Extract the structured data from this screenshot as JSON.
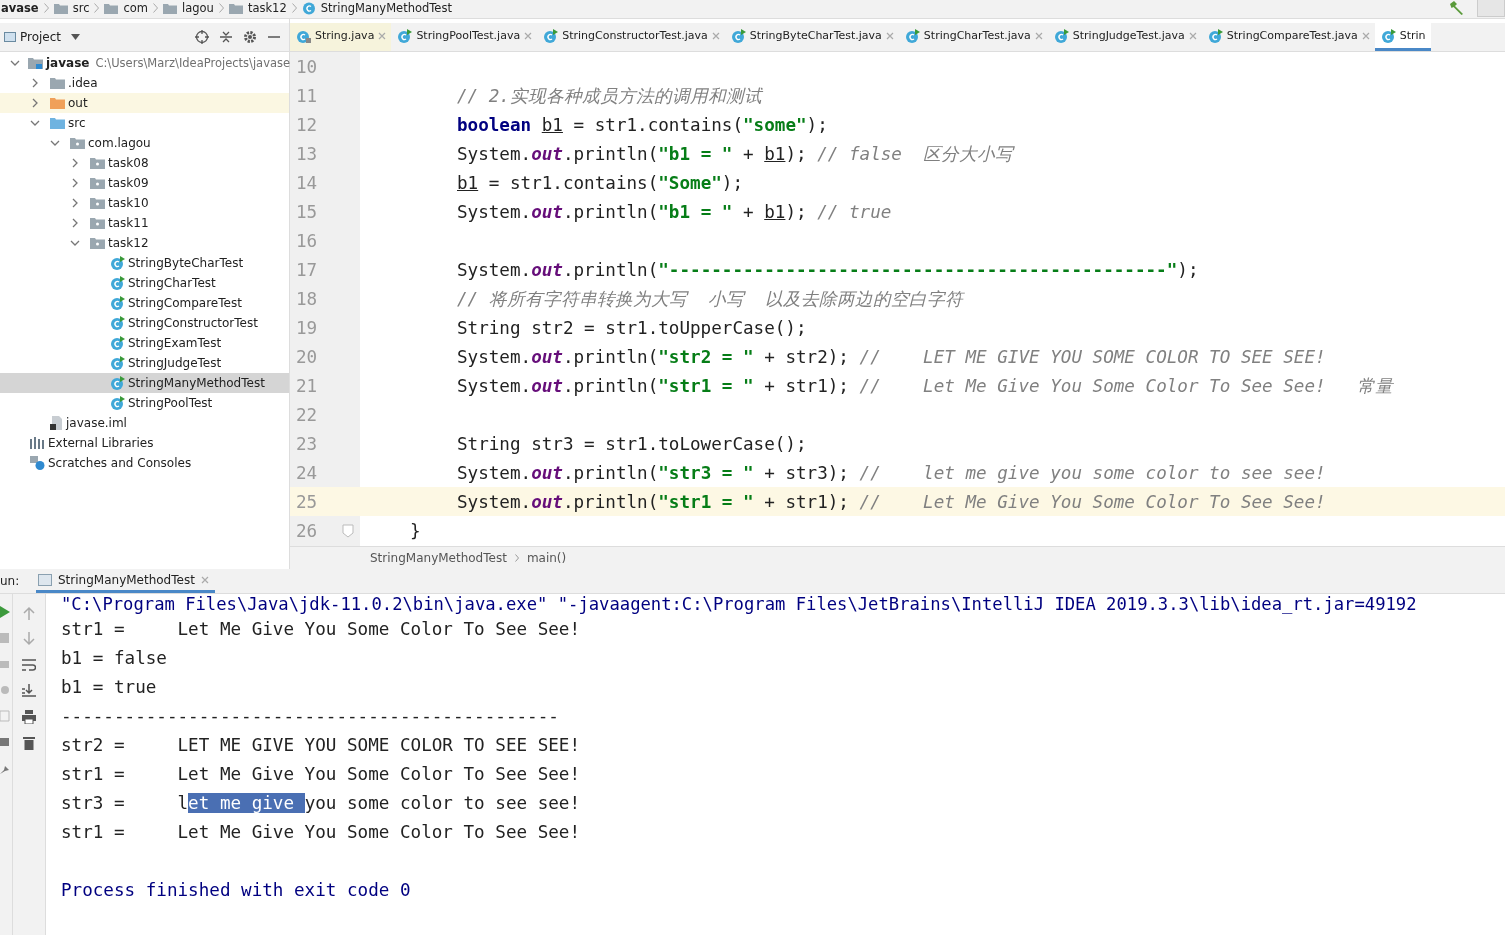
{
  "breadcrumbs": [
    "avase",
    "src",
    "com",
    "lagou",
    "task12",
    "StringManyMethodTest"
  ],
  "project_panel": {
    "title": "Project"
  },
  "tabs": [
    {
      "label": "String.java",
      "kind": "library",
      "selected": false
    },
    {
      "label": "StringPoolTest.java",
      "kind": "class",
      "selected": false
    },
    {
      "label": "StringConstructorTest.java",
      "kind": "class",
      "selected": false
    },
    {
      "label": "StringByteCharTest.java",
      "kind": "class",
      "selected": false
    },
    {
      "label": "StringCharTest.java",
      "kind": "class",
      "selected": false
    },
    {
      "label": "StringJudgeTest.java",
      "kind": "class",
      "selected": false
    },
    {
      "label": "StringCompareTest.java",
      "kind": "class",
      "selected": false
    },
    {
      "label": "Strin",
      "kind": "class",
      "selected": true
    }
  ],
  "tree": [
    {
      "label": "javase",
      "path": "C:\\Users\\Marz\\IdeaProjects\\javase",
      "kind": "module",
      "expanded": true,
      "selected": false,
      "children": [
        {
          "label": ".idea",
          "kind": "folder",
          "expanded": false,
          "selected": false
        },
        {
          "label": "out",
          "kind": "excluded",
          "expanded": false,
          "selected": false
        },
        {
          "label": "src",
          "kind": "source",
          "expanded": true,
          "selected": false,
          "children": [
            {
              "label": "com.lagou",
              "kind": "package",
              "expanded": true,
              "selected": false,
              "children": [
                {
                  "label": "task08",
                  "kind": "package",
                  "expanded": false,
                  "selected": false
                },
                {
                  "label": "task09",
                  "kind": "package",
                  "expanded": false,
                  "selected": false
                },
                {
                  "label": "task10",
                  "kind": "package",
                  "expanded": false,
                  "selected": false
                },
                {
                  "label": "task11",
                  "kind": "package",
                  "expanded": false,
                  "selected": false
                },
                {
                  "label": "task12",
                  "kind": "package",
                  "expanded": true,
                  "selected": false,
                  "children": [
                    {
                      "label": "StringByteCharTest",
                      "kind": "class",
                      "selected": false
                    },
                    {
                      "label": "StringCharTest",
                      "kind": "class",
                      "selected": false
                    },
                    {
                      "label": "StringCompareTest",
                      "kind": "class",
                      "selected": false
                    },
                    {
                      "label": "StringConstructorTest",
                      "kind": "class",
                      "selected": false
                    },
                    {
                      "label": "StringExamTest",
                      "kind": "class",
                      "selected": false
                    },
                    {
                      "label": "StringJudgeTest",
                      "kind": "class",
                      "selected": false
                    },
                    {
                      "label": "StringManyMethodTest",
                      "kind": "class",
                      "selected": true
                    },
                    {
                      "label": "StringPoolTest",
                      "kind": "class",
                      "selected": false
                    }
                  ]
                }
              ]
            }
          ]
        },
        {
          "label": "javase.iml",
          "kind": "file",
          "selected": false
        }
      ]
    },
    {
      "label": "External Libraries",
      "kind": "libraries",
      "selected": false
    },
    {
      "label": "Scratches and Consoles",
      "kind": "scratches",
      "selected": false
    }
  ],
  "code": [
    {
      "number": "10",
      "kind": "body",
      "current": false
    },
    {
      "number": "11",
      "kind": "body",
      "current": false,
      "tokens": [
        {
          "kind": "comment",
          "text": "// 2.实现各种成员方法的调用和测试"
        }
      ]
    },
    {
      "number": "12",
      "kind": "body",
      "current": false,
      "tokens": [
        {
          "kind": "keyword",
          "text": "boolean "
        },
        {
          "kind": "var",
          "text": "b1"
        },
        {
          "kind": "text",
          "text": " = str1.contains("
        },
        {
          "kind": "string",
          "text": "\"some\""
        },
        {
          "kind": "text",
          "text": ");"
        }
      ]
    },
    {
      "number": "13",
      "kind": "body",
      "current": false,
      "tokens": [
        {
          "kind": "text",
          "text": "System."
        },
        {
          "kind": "field",
          "text": "out"
        },
        {
          "kind": "text",
          "text": ".println("
        },
        {
          "kind": "string",
          "text": "\"b1 = \""
        },
        {
          "kind": "text",
          "text": " + "
        },
        {
          "kind": "var",
          "text": "b1"
        },
        {
          "kind": "text",
          "text": "); "
        },
        {
          "kind": "comment",
          "text": "// false  区分大小写"
        }
      ]
    },
    {
      "number": "14",
      "kind": "body",
      "current": false,
      "tokens": [
        {
          "kind": "var",
          "text": "b1"
        },
        {
          "kind": "text",
          "text": " = str1.contains("
        },
        {
          "kind": "string",
          "text": "\"Some\""
        },
        {
          "kind": "text",
          "text": ");"
        }
      ]
    },
    {
      "number": "15",
      "kind": "body",
      "current": false,
      "tokens": [
        {
          "kind": "text",
          "text": "System."
        },
        {
          "kind": "field",
          "text": "out"
        },
        {
          "kind": "text",
          "text": ".println("
        },
        {
          "kind": "string",
          "text": "\"b1 = \""
        },
        {
          "kind": "text",
          "text": " + "
        },
        {
          "kind": "var",
          "text": "b1"
        },
        {
          "kind": "text",
          "text": "); "
        },
        {
          "kind": "comment",
          "text": "// true"
        }
      ]
    },
    {
      "number": "16",
      "kind": "body",
      "current": false
    },
    {
      "number": "17",
      "kind": "body",
      "current": false,
      "tokens": [
        {
          "kind": "text",
          "text": "System."
        },
        {
          "kind": "field",
          "text": "out"
        },
        {
          "kind": "text",
          "text": ".println("
        },
        {
          "kind": "string",
          "text": "\"-----------------------------------------------\""
        },
        {
          "kind": "text",
          "text": ");"
        }
      ]
    },
    {
      "number": "18",
      "kind": "body",
      "current": false,
      "tokens": [
        {
          "kind": "comment",
          "text": "// 将所有字符串转换为大写  小写  以及去除两边的空白字符"
        }
      ]
    },
    {
      "number": "19",
      "kind": "body",
      "current": false,
      "tokens": [
        {
          "kind": "text",
          "text": "String str2 = str1.toUpperCase();"
        }
      ]
    },
    {
      "number": "20",
      "kind": "body",
      "current": false,
      "tokens": [
        {
          "kind": "text",
          "text": "System."
        },
        {
          "kind": "field",
          "text": "out"
        },
        {
          "kind": "text",
          "text": ".println("
        },
        {
          "kind": "string",
          "text": "\"str2 = \""
        },
        {
          "kind": "text",
          "text": " + str2); "
        },
        {
          "kind": "comment",
          "text": "//    LET ME GIVE YOU SOME COLOR TO SEE SEE!"
        }
      ]
    },
    {
      "number": "21",
      "kind": "body",
      "current": false,
      "tokens": [
        {
          "kind": "text",
          "text": "System."
        },
        {
          "kind": "field",
          "text": "out"
        },
        {
          "kind": "text",
          "text": ".println("
        },
        {
          "kind": "string",
          "text": "\"str1 = \""
        },
        {
          "kind": "text",
          "text": " + str1); "
        },
        {
          "kind": "comment",
          "text": "//    Let Me Give You Some Color To See See!   常量"
        }
      ]
    },
    {
      "number": "22",
      "kind": "body",
      "current": false
    },
    {
      "number": "23",
      "kind": "body",
      "current": false,
      "tokens": [
        {
          "kind": "text",
          "text": "String str3 = str1.toLowerCase();"
        }
      ]
    },
    {
      "number": "24",
      "kind": "body",
      "current": false,
      "tokens": [
        {
          "kind": "text",
          "text": "System."
        },
        {
          "kind": "field",
          "text": "out"
        },
        {
          "kind": "text",
          "text": ".println("
        },
        {
          "kind": "string",
          "text": "\"str3 = \""
        },
        {
          "kind": "text",
          "text": " + str3); "
        },
        {
          "kind": "comment",
          "text": "//    let me give you some color to see see!"
        }
      ]
    },
    {
      "number": "25",
      "kind": "body",
      "current": true,
      "tokens": [
        {
          "kind": "text",
          "text": "System."
        },
        {
          "kind": "field",
          "text": "out"
        },
        {
          "kind": "text",
          "text": ".println("
        },
        {
          "kind": "string",
          "text": "\"str1 = \""
        },
        {
          "kind": "text",
          "text": " + str1); "
        },
        {
          "kind": "comment",
          "text": "//    Let Me Give You Some Color To See See!"
        }
      ]
    },
    {
      "number": "26",
      "kind": "close",
      "current": false,
      "tokens": [
        {
          "kind": "text",
          "text": "}"
        }
      ]
    }
  ],
  "editor_breadcrumbs": [
    "StringManyMethodTest",
    "main()"
  ],
  "run_panel": {
    "label": "un:",
    "tab": "StringManyMethodTest"
  },
  "console": [
    {
      "kind": "command",
      "segments": [
        {
          "text": "\"C:\\Program Files\\Java\\jdk-11.0.2\\bin\\java.exe\" \"-javaagent:C:\\Program Files\\JetBrains\\IntelliJ IDEA 2019.3.3\\lib\\idea_rt.jar=49192",
          "selected": false
        }
      ]
    },
    {
      "kind": "output",
      "segments": [
        {
          "text": "str1 =     Let Me Give You Some Color To See See!",
          "selected": false
        }
      ]
    },
    {
      "kind": "output",
      "segments": [
        {
          "text": "b1 = false",
          "selected": false
        }
      ]
    },
    {
      "kind": "output",
      "segments": [
        {
          "text": "b1 = true",
          "selected": false
        }
      ]
    },
    {
      "kind": "output",
      "segments": [
        {
          "text": "-----------------------------------------------",
          "selected": false
        }
      ]
    },
    {
      "kind": "output",
      "segments": [
        {
          "text": "str2 =     LET ME GIVE YOU SOME COLOR TO SEE SEE!",
          "selected": false
        }
      ]
    },
    {
      "kind": "output",
      "segments": [
        {
          "text": "str1 =     Let Me Give You Some Color To See See!",
          "selected": false
        }
      ]
    },
    {
      "kind": "output",
      "segments": [
        {
          "text": "str3 =     l",
          "selected": false
        },
        {
          "text": "et me give ",
          "selected": true
        },
        {
          "text": "you some color to see see!",
          "selected": false
        }
      ]
    },
    {
      "kind": "output",
      "segments": [
        {
          "text": "str1 =     Let Me Give You Some Color To See See!",
          "selected": false
        }
      ]
    },
    {
      "kind": "blank"
    },
    {
      "kind": "exit",
      "segments": [
        {
          "text": "Process finished with exit code 0",
          "selected": false
        }
      ]
    }
  ]
}
